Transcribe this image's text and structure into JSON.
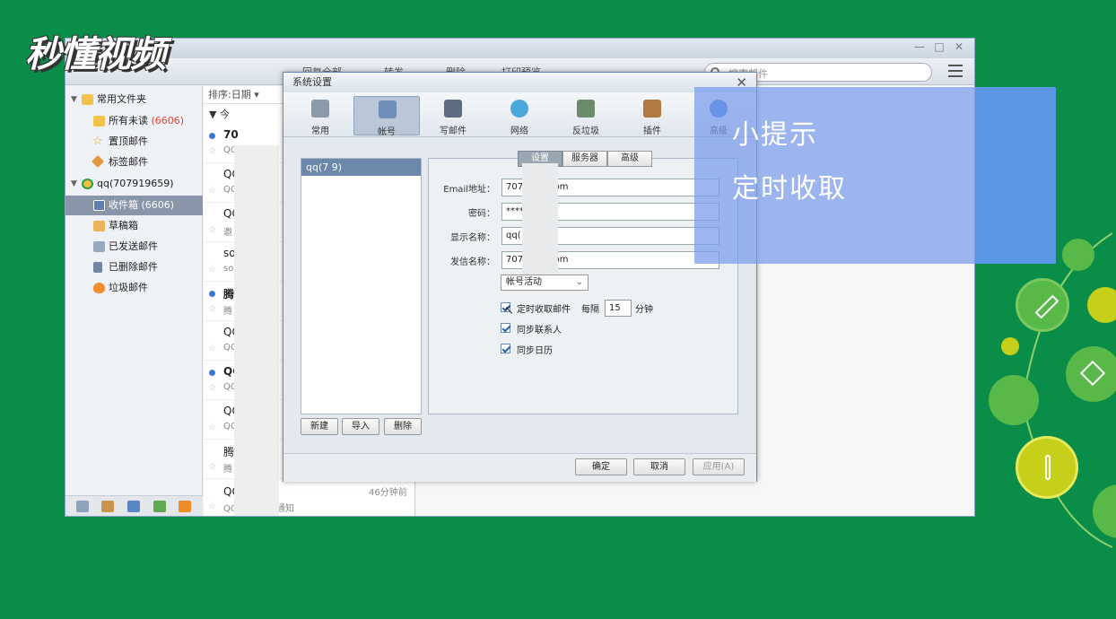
{
  "watermark": {
    "logo_text": "秒懂视频"
  },
  "main_window": {
    "toolbar": {
      "reply_all": "回复全部",
      "forward": "转发",
      "delete": "删除",
      "print_preview": "打印预览",
      "search_placeholder": "搜索邮件"
    },
    "sidebar": {
      "common_folders": "常用文件夹",
      "all_unread": "所有未读",
      "all_unread_count": "(6606)",
      "pinned": "置顶邮件",
      "tagged": "标签邮件",
      "account": "qq(707919659)",
      "inbox": "收件箱",
      "inbox_count": "(6606)",
      "drafts": "草稿箱",
      "sent": "已发送邮件",
      "deleted": "已删除邮件",
      "junk": "垃圾邮件"
    },
    "list": {
      "sort_label": "排序:日期",
      "group_today": "今",
      "rows": [
        {
          "sender": "70",
          "subject": "QC",
          "bold": true,
          "unread": true
        },
        {
          "sender": "QC",
          "subject": "QC",
          "bold": false,
          "unread": false
        },
        {
          "sender": "QC",
          "subject": "邀",
          "bold": false,
          "unread": false
        },
        {
          "sender": "so",
          "subject": "so",
          "bold": false,
          "unread": false
        },
        {
          "sender": "腾",
          "subject": "腾",
          "bold": true,
          "unread": true
        },
        {
          "sender": "QC",
          "subject": "QC",
          "bold": false,
          "unread": false
        },
        {
          "sender": "QC",
          "subject": "QC",
          "bold": true,
          "unread": true
        },
        {
          "sender": "QC",
          "subject": "QC",
          "bold": false,
          "unread": false
        },
        {
          "sender": "腾",
          "subject": "腾",
          "bold": false,
          "unread": false
        },
        {
          "sender": "QC        小组",
          "subject": "QQ邮箱 业务通知",
          "bold": false,
          "unread": false,
          "time": "46分钟前"
        }
      ]
    }
  },
  "dialog": {
    "title": "系统设置",
    "tabs": [
      {
        "label": "常用",
        "icon": "phone-icon",
        "color": "#8a9aaa"
      },
      {
        "label": "帐号",
        "icon": "user-icon",
        "color": "#6f8fb8"
      },
      {
        "label": "写邮件",
        "icon": "stamp-icon",
        "color": "#5e6d80"
      },
      {
        "label": "网络",
        "icon": "globe-icon",
        "color": "#4aa7d9"
      },
      {
        "label": "反垃圾",
        "icon": "shield-icon",
        "color": "#6c8a6c"
      },
      {
        "label": "插件",
        "icon": "box-icon",
        "color": "#b07a3f"
      },
      {
        "label": "高级",
        "icon": "gear-icon",
        "color": "#3f7ed6"
      }
    ],
    "account_list": {
      "selected": "qq(7          9)"
    },
    "buttons": {
      "new": "新建",
      "import": "导入",
      "delete": "删除"
    },
    "subtabs": [
      "设置",
      "服务器",
      "高级"
    ],
    "fields": {
      "email_label": "Email地址：",
      "email_value": "707                @qq.com",
      "password_label": "密码：",
      "password_value": "****                ****",
      "display_label": "显示名称：",
      "display_value": "qq(                59)",
      "sender_label": "发信名称：",
      "sender_value": "707                @qq.com"
    },
    "account_activity": "帐号活动",
    "options": {
      "timed_fetch": "定时收取邮件",
      "every": "每隔",
      "interval": "15",
      "minutes": "分钟",
      "sync_contacts": "同步联系人",
      "sync_calendar": "同步日历"
    },
    "footer": {
      "ok": "确定",
      "cancel": "取消",
      "apply": "应用(A)"
    }
  },
  "tip": {
    "line1": "小提示",
    "line2": "定时收取"
  },
  "colors": {
    "background": "#0a8d49",
    "tip_overlay": "#789beb",
    "deco_light": "#58b848",
    "deco_yellow": "#c6cf1a"
  }
}
